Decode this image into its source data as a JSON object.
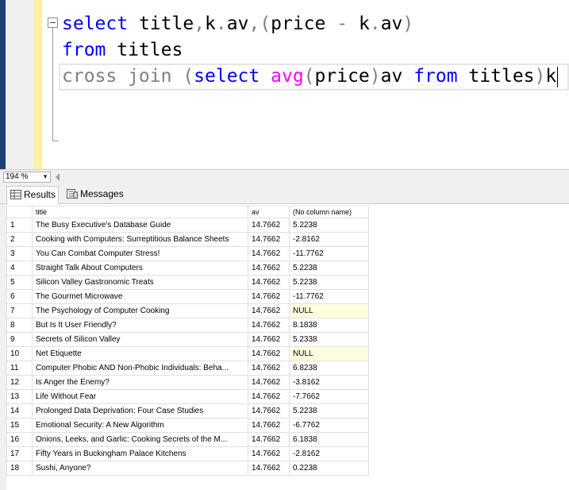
{
  "editor": {
    "zoom": "194 %"
  },
  "tabs": {
    "results": "Results",
    "messages": "Messages"
  },
  "results": {
    "columns": [
      "title",
      "av",
      "(No column name)"
    ],
    "rows": [
      {
        "n": "1",
        "title": "The Busy Executive's Database Guide",
        "av": "14.7662",
        "nc": "5.2238"
      },
      {
        "n": "2",
        "title": "Cooking with Computers: Surreptitious Balance Sheets",
        "av": "14.7662",
        "nc": "-2.8162"
      },
      {
        "n": "3",
        "title": "You Can Combat Computer Stress!",
        "av": "14.7662",
        "nc": "-11.7762"
      },
      {
        "n": "4",
        "title": "Straight Talk About Computers",
        "av": "14.7662",
        "nc": "5.2238"
      },
      {
        "n": "5",
        "title": "Silicon Valley Gastronomic Treats",
        "av": "14.7662",
        "nc": "5.2238"
      },
      {
        "n": "6",
        "title": "The Gourmet Microwave",
        "av": "14.7662",
        "nc": "-11.7762"
      },
      {
        "n": "7",
        "title": "The Psychology of Computer Cooking",
        "av": "14.7662",
        "nc": "NULL"
      },
      {
        "n": "8",
        "title": "But Is It User Friendly?",
        "av": "14.7662",
        "nc": "8.1838"
      },
      {
        "n": "9",
        "title": "Secrets of Silicon Valley",
        "av": "14.7662",
        "nc": "5.2338"
      },
      {
        "n": "10",
        "title": "Net Etiquette",
        "av": "14.7662",
        "nc": "NULL"
      },
      {
        "n": "11",
        "title": "Computer Phobic AND Non-Phobic Individuals: Beha...",
        "av": "14.7662",
        "nc": "6.8238"
      },
      {
        "n": "12",
        "title": "Is Anger the Enemy?",
        "av": "14.7662",
        "nc": "-3.8162"
      },
      {
        "n": "13",
        "title": "Life Without Fear",
        "av": "14.7662",
        "nc": "-7.7662"
      },
      {
        "n": "14",
        "title": "Prolonged Data Deprivation: Four Case Studies",
        "av": "14.7662",
        "nc": "5.2238"
      },
      {
        "n": "15",
        "title": "Emotional Security: A New Algorithm",
        "av": "14.7662",
        "nc": "-6.7762"
      },
      {
        "n": "16",
        "title": "Onions, Leeks, and Garlic: Cooking Secrets of the M...",
        "av": "14.7662",
        "nc": "6.1838"
      },
      {
        "n": "17",
        "title": "Fifty Years in Buckingham Palace Kitchens",
        "av": "14.7662",
        "nc": "-2.8162"
      },
      {
        "n": "18",
        "title": "Sushi, Anyone?",
        "av": "14.7662",
        "nc": "0.2238"
      }
    ]
  },
  "colors": {
    "keyword": "#0000ff",
    "operator": "#808080",
    "function": "#ff00ff",
    "null_cell": "#ffffe0",
    "margin_yellow": "#fdf2a0"
  }
}
